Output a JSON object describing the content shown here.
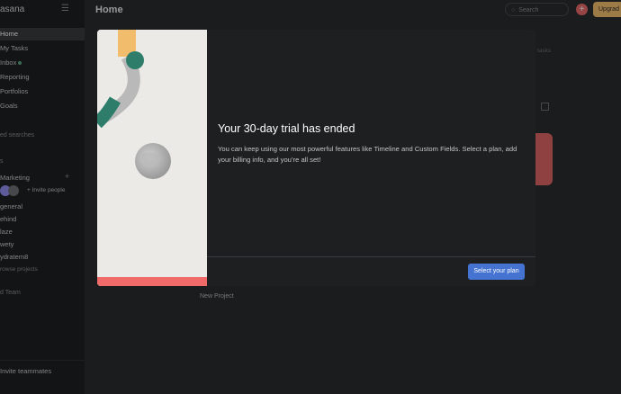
{
  "sidebar": {
    "logo": "asana",
    "items": [
      {
        "label": "Home",
        "active": true
      },
      {
        "label": "My Tasks"
      },
      {
        "label": "Inbox"
      },
      {
        "label": "Reporting"
      },
      {
        "label": "Portfolios"
      },
      {
        "label": "Goals"
      }
    ],
    "saved_searches": "ed searches",
    "section_short": "s",
    "team_name": "Marketing",
    "invite_people": "Invite people",
    "projects": [
      "general",
      "ehind",
      "laze",
      "wety",
      "ydratem8"
    ],
    "browse_projects": "rowse projects",
    "add_team": "d Team",
    "invite_teammates": "Invite teammates"
  },
  "topbar": {
    "title": "Home",
    "search_placeholder": "Search",
    "upgrade_label": "Upgrad"
  },
  "background": {
    "tasks_hint": "tasks",
    "new_project": "New Project"
  },
  "modal": {
    "title": "Your 30-day trial has ended",
    "body": "You can keep using our most powerful features like Timeline and Custom Fields. Select a plan, add your billing info, and you’re all set!",
    "cta": "Select your plan"
  },
  "colors": {
    "accent": "#4573d2",
    "upgrade": "#f1bd6c",
    "add": "#e8696b",
    "art_yellow": "#f1bd6c",
    "art_teal": "#2e7d6b",
    "art_coral": "#f06a6a"
  }
}
